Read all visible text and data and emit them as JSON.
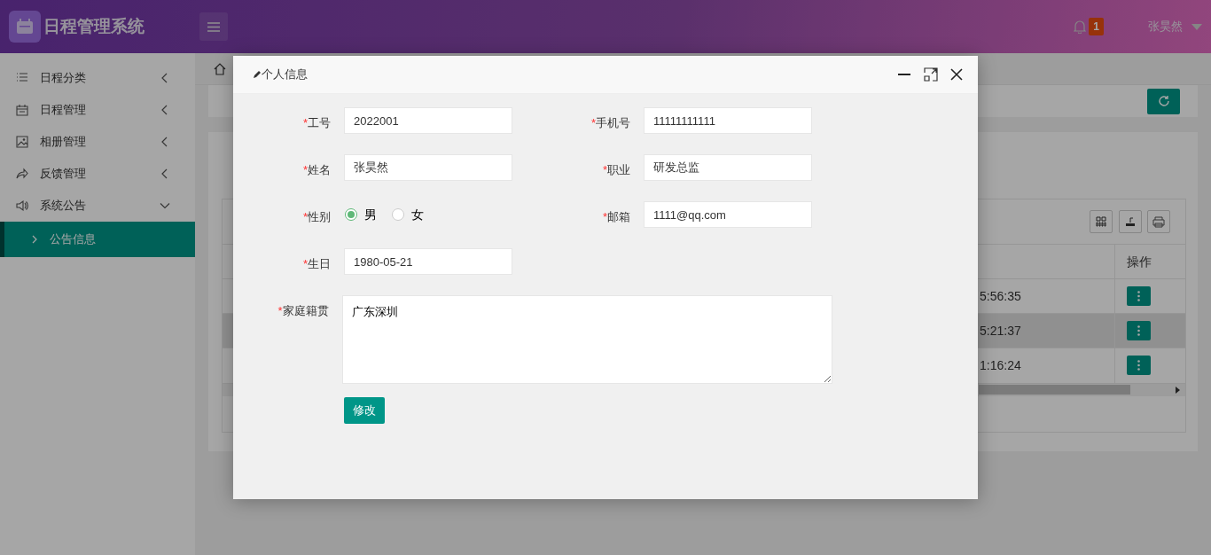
{
  "header": {
    "title": "日程管理系统",
    "notification_count": "1",
    "user": "张昊然"
  },
  "sidebar": {
    "items": [
      {
        "label": "日程分类",
        "expanded": false
      },
      {
        "label": "日程管理",
        "expanded": false
      },
      {
        "label": "相册管理",
        "expanded": false
      },
      {
        "label": "反馈管理",
        "expanded": false
      },
      {
        "label": "系统公告",
        "expanded": true,
        "children": [
          {
            "label": "公告信息",
            "selected": true
          }
        ]
      }
    ]
  },
  "background": {
    "table": {
      "columns": [
        "操作"
      ],
      "rows": [
        {
          "time": "5:56:35",
          "selected": false
        },
        {
          "time": "5:21:37",
          "selected": true
        },
        {
          "time": "1:16:24",
          "selected": false
        }
      ]
    }
  },
  "dialog": {
    "title": "个人信息",
    "fields": [
      {
        "kind": "text",
        "mark": "*",
        "label": "工号",
        "value": "2022001"
      },
      {
        "kind": "text",
        "mark": "*",
        "label": "手机号",
        "value": "11111111111"
      },
      {
        "kind": "text",
        "mark": "*",
        "label": "姓名",
        "value": "张昊然"
      },
      {
        "kind": "text",
        "mark": "*",
        "label": "职业",
        "value": "研发总监"
      },
      {
        "kind": "radio",
        "mark": "*",
        "label": "性别",
        "options": [
          {
            "label": "男",
            "selected": true
          },
          {
            "label": "女",
            "selected": false
          }
        ]
      },
      {
        "kind": "text",
        "mark": "*",
        "label": "邮箱",
        "value": "1111@qq.com"
      },
      {
        "kind": "text",
        "mark": "*",
        "label": "生日",
        "value": "1980-05-21"
      },
      {
        "kind": "textarea",
        "mark": "*",
        "label": "家庭籍贯",
        "value": "广东深圳"
      }
    ],
    "button": "修改"
  }
}
